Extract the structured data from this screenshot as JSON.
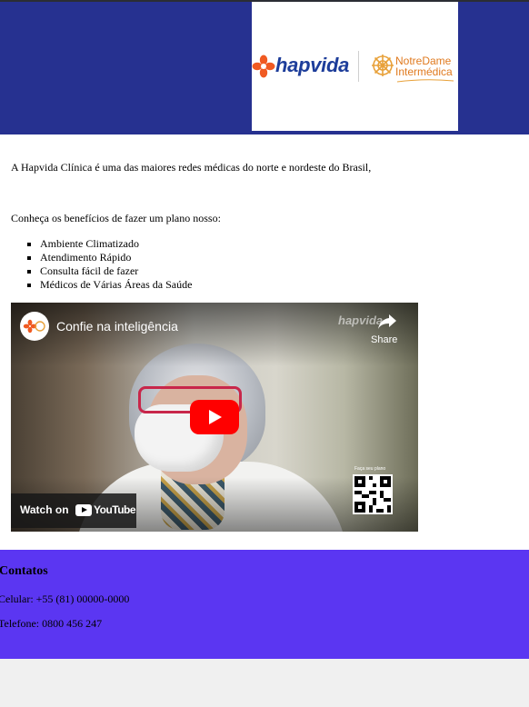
{
  "header": {
    "logo_primary": "hapvida",
    "logo_secondary_line1": "NotreDame",
    "logo_secondary_line2": "Intermédica",
    "colors": {
      "background": "#263190",
      "hapvida_blue": "#1d3d9a",
      "hapvida_orange": "#f05a22",
      "notredame_orange": "#e07a1f"
    }
  },
  "main": {
    "intro": "A Hapvida Clínica é uma das maiores redes médicas do norte e nordeste do Brasil,",
    "benefits_title": "Conheça os benefícios de fazer um plano nosso:",
    "benefits": [
      "Ambiente Climatizado",
      "Atendimento Rápido",
      "Consulta fácil de fazer",
      "Médicos de Várias Áreas da Saúde"
    ]
  },
  "video": {
    "title": "Confie na inteligência",
    "share_label": "Share",
    "channel_mark": "hapvida",
    "qr_label": "Faça seu plano",
    "watch_on": "Watch on",
    "youtube": "YouTube",
    "icons": [
      "channel-avatar-icon",
      "share-icon",
      "play-icon",
      "youtube-icon",
      "qr-code-icon"
    ]
  },
  "footer": {
    "title": "Contatos",
    "phone": "Celular: +55 (81) 00000-0000",
    "telephone": "Telefone: 0800 456 247",
    "background": "#5b36f2"
  }
}
